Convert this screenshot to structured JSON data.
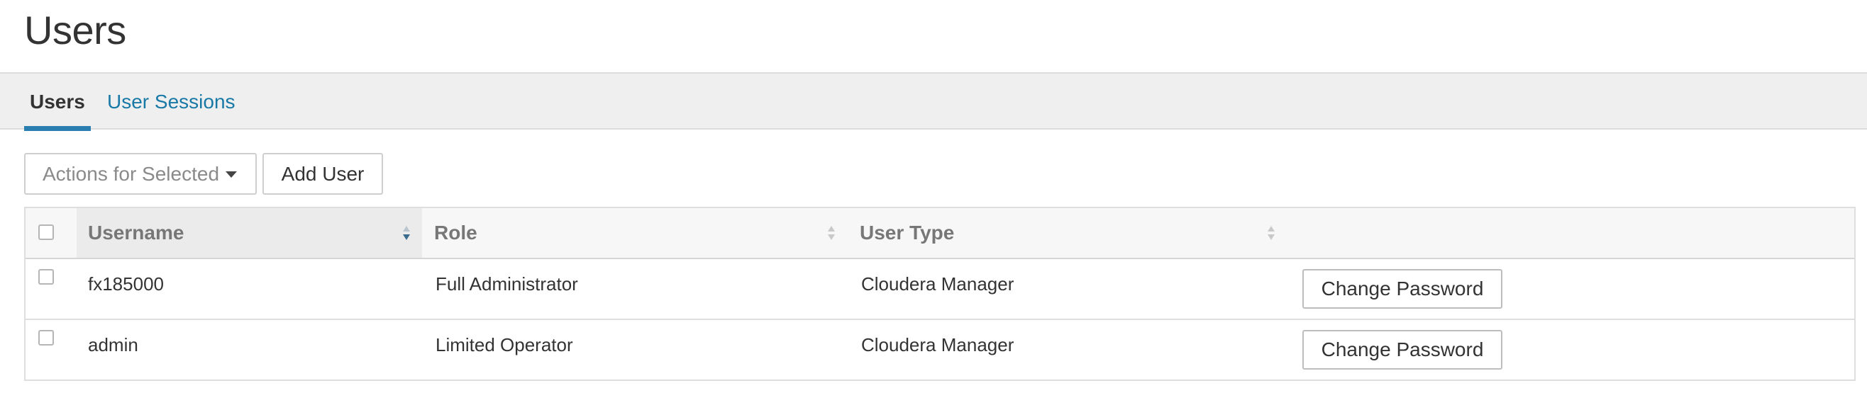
{
  "page": {
    "title": "Users"
  },
  "tabs": [
    {
      "label": "Users",
      "active": true
    },
    {
      "label": "User Sessions",
      "active": false
    }
  ],
  "toolbar": {
    "actions_label": "Actions for Selected",
    "add_user_label": "Add User"
  },
  "table": {
    "columns": [
      "Username",
      "Role",
      "User Type"
    ],
    "sorted_column": "Username",
    "rows": [
      {
        "username": "fx185000",
        "role": "Full Administrator",
        "user_type": "Cloudera Manager",
        "action": "Change Password"
      },
      {
        "username": "admin",
        "role": "Limited Operator",
        "user_type": "Cloudera Manager",
        "action": "Change Password"
      }
    ]
  },
  "colors": {
    "accent": "#2a7fb0",
    "link": "#1879a6",
    "tabbar_bg": "#f0eff0"
  }
}
